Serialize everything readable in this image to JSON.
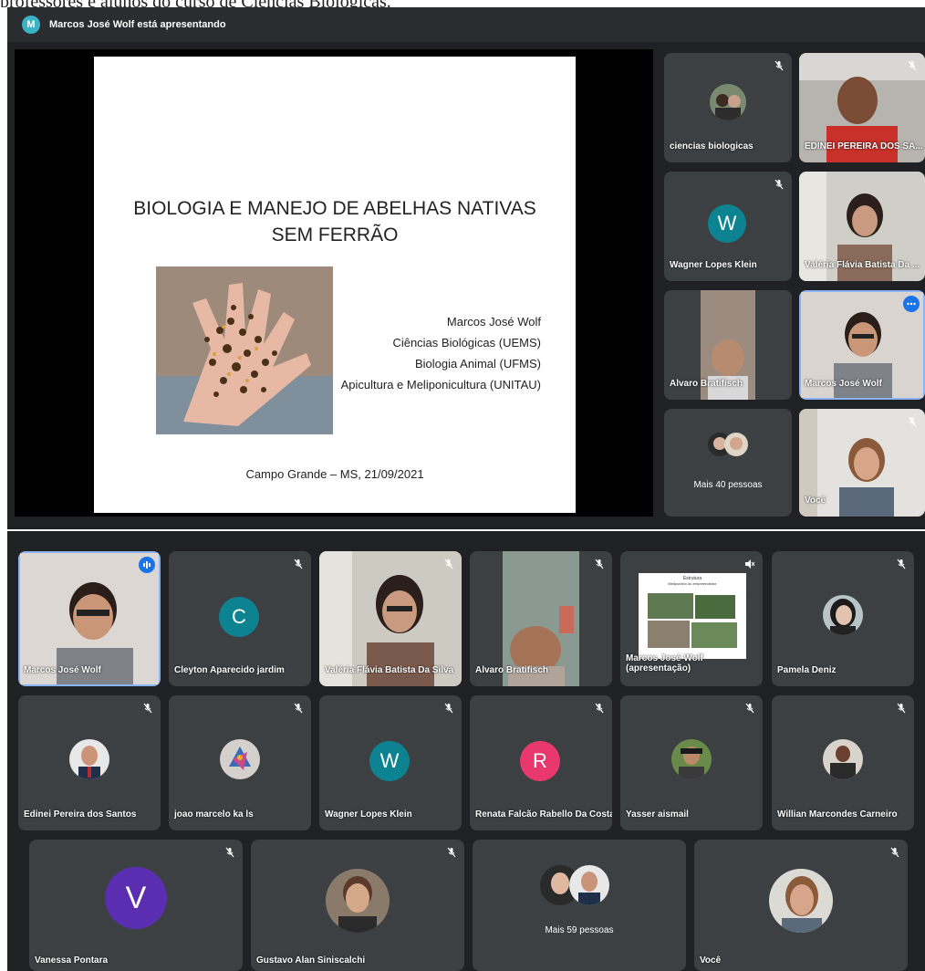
{
  "caption": "professores e alunos do curso de Ciências Biológicas.",
  "presenting": {
    "initial": "M",
    "text": "Marcos José Wolf está apresentando"
  },
  "slide": {
    "title_line1": "BIOLOGIA E MANEJO DE ABELHAS NATIVAS",
    "title_line2": "SEM FERRÃO",
    "author": "Marcos José Wolf",
    "credentials": [
      "Ciências Biológicas (UEMS)",
      "Biologia Animal (UFMS)",
      "Apicultura e Meliponicultura (UNITAU)"
    ],
    "footer": "Campo Grande – MS, 21/09/2021"
  },
  "top_tiles": [
    {
      "name": "ciencias biologicas"
    },
    {
      "name": "EDINEI PEREIRA DOS SA..."
    },
    {
      "name": "Wagner Lopes Klein",
      "initial": "W"
    },
    {
      "name": "Valéria Flávia Batista Da ..."
    },
    {
      "name": "Alvaro Bratifisch"
    },
    {
      "name": "Marcos José Wolf"
    },
    {
      "name": "Mais 40 pessoas"
    },
    {
      "name": "Você"
    }
  ],
  "grid": {
    "row1": [
      {
        "name": "Marcos José Wolf"
      },
      {
        "name": "Cleyton Aparecido jardim",
        "initial": "C"
      },
      {
        "name": "Valéria Flávia Batista Da Silva"
      },
      {
        "name": "Alvaro Bratifisch"
      },
      {
        "name": "Marcos José Wolf",
        "name2": "(apresentação)",
        "mini_title": "Estrutura",
        "mini_subtitle": "Meliponário do empreendedor"
      },
      {
        "name": "Pamela Deniz"
      }
    ],
    "row2": [
      {
        "name": "Edinei Pereira dos Santos"
      },
      {
        "name": "joao marcelo ka ls"
      },
      {
        "name": "Wagner Lopes Klein",
        "initial": "W"
      },
      {
        "name": "Renata Falcão Rabello Da Costa",
        "initial": "R"
      },
      {
        "name": "Yasser aismail"
      },
      {
        "name": "Willian Marcondes Carneiro"
      }
    ],
    "row3": [
      {
        "name": "Vanessa Pontara",
        "initial": "V"
      },
      {
        "name": "Gustavo Alan Siniscalchi"
      },
      {
        "name": "Mais 59 pessoas"
      },
      {
        "name": "Você"
      }
    ]
  },
  "colors": {
    "bg": "#202124",
    "tile": "#3c4043",
    "teal": "#0d8391",
    "pink": "#e8386d",
    "purple": "#5b2db0",
    "active": "#8ab4f8"
  }
}
